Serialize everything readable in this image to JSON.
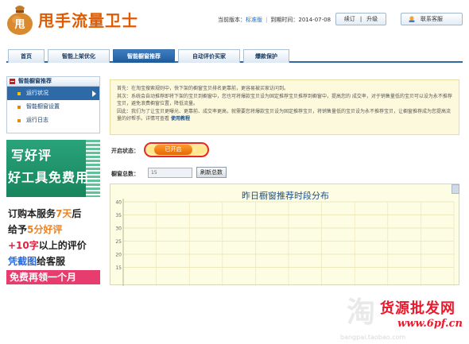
{
  "header": {
    "app_name": "甩手流量卫士",
    "logo_glyph": "甩",
    "version_label": "当前版本：",
    "version_value": "标准版",
    "expire_label": "到期时间：",
    "expire_value": "2014-07-08",
    "renew_label": "续订",
    "upgrade_label": "升级",
    "support_label": "联系客服"
  },
  "nav": {
    "tabs": [
      {
        "label": "首页"
      },
      {
        "label": "智能上架优化"
      },
      {
        "label": "智能橱窗推荐"
      },
      {
        "label": "自动评价买家"
      },
      {
        "label": "爆款保护"
      }
    ],
    "active_index": 2
  },
  "sidebar": {
    "title": "智能橱窗推荐",
    "items": [
      {
        "label": "运行状况"
      },
      {
        "label": "智能橱窗设置"
      },
      {
        "label": "运行日志"
      }
    ]
  },
  "ad": {
    "line1": "写好评",
    "line2": "好工具免费用",
    "row1_a": "订购本服务",
    "row1_b": "7天",
    "row1_c": "后",
    "row2_a": "给予",
    "row2_b": "5分好评",
    "row3_a": "+10字",
    "row3_b": "以上的评价",
    "row4_a": "凭截图",
    "row4_b": "给客服",
    "row5": "免费再领一个月"
  },
  "notice": {
    "p1": "首先：在淘宝搜索规则中，快下架的橱窗宝贝排名更靠前，更容易被买家访问到。",
    "p2": "其次：系统会自动推荐即将下架的宝贝到橱窗中，您也可将爆款宝贝设为固定推荐宝贝推荐到橱窗中，提高您的 成交率，对于销售量低的宝贝可以设为永不推荐宝贝，避免浪费橱窗位置，降低流量。",
    "p3a": "因此：我们为了让宝贝更曝光、更靠前、成交率更高，就需要您将爆款宝贝设为固定推荐宝贝，将销售量低的宝贝设为永不推荐宝贝，让橱窗推荐成为您提高流量的好帮手。详情可查看",
    "p3_link": "使用教程"
  },
  "status": {
    "label": "开启状态：",
    "toggle_label": "已开启"
  },
  "count": {
    "label": "橱窗总数：",
    "value": "15",
    "refresh_label": "刷新总数"
  },
  "chart_data": {
    "type": "line",
    "title": "昨日橱窗推荐时段分布",
    "xlabel": "",
    "ylabel": "",
    "yticks": [
      40,
      35,
      30,
      25,
      20,
      15
    ],
    "grid": true,
    "series": []
  },
  "watermark": {
    "title": "货源批发网",
    "url": "www.6pf.cn",
    "ghost": "淘",
    "foot": "bangpai.taobao.com"
  }
}
